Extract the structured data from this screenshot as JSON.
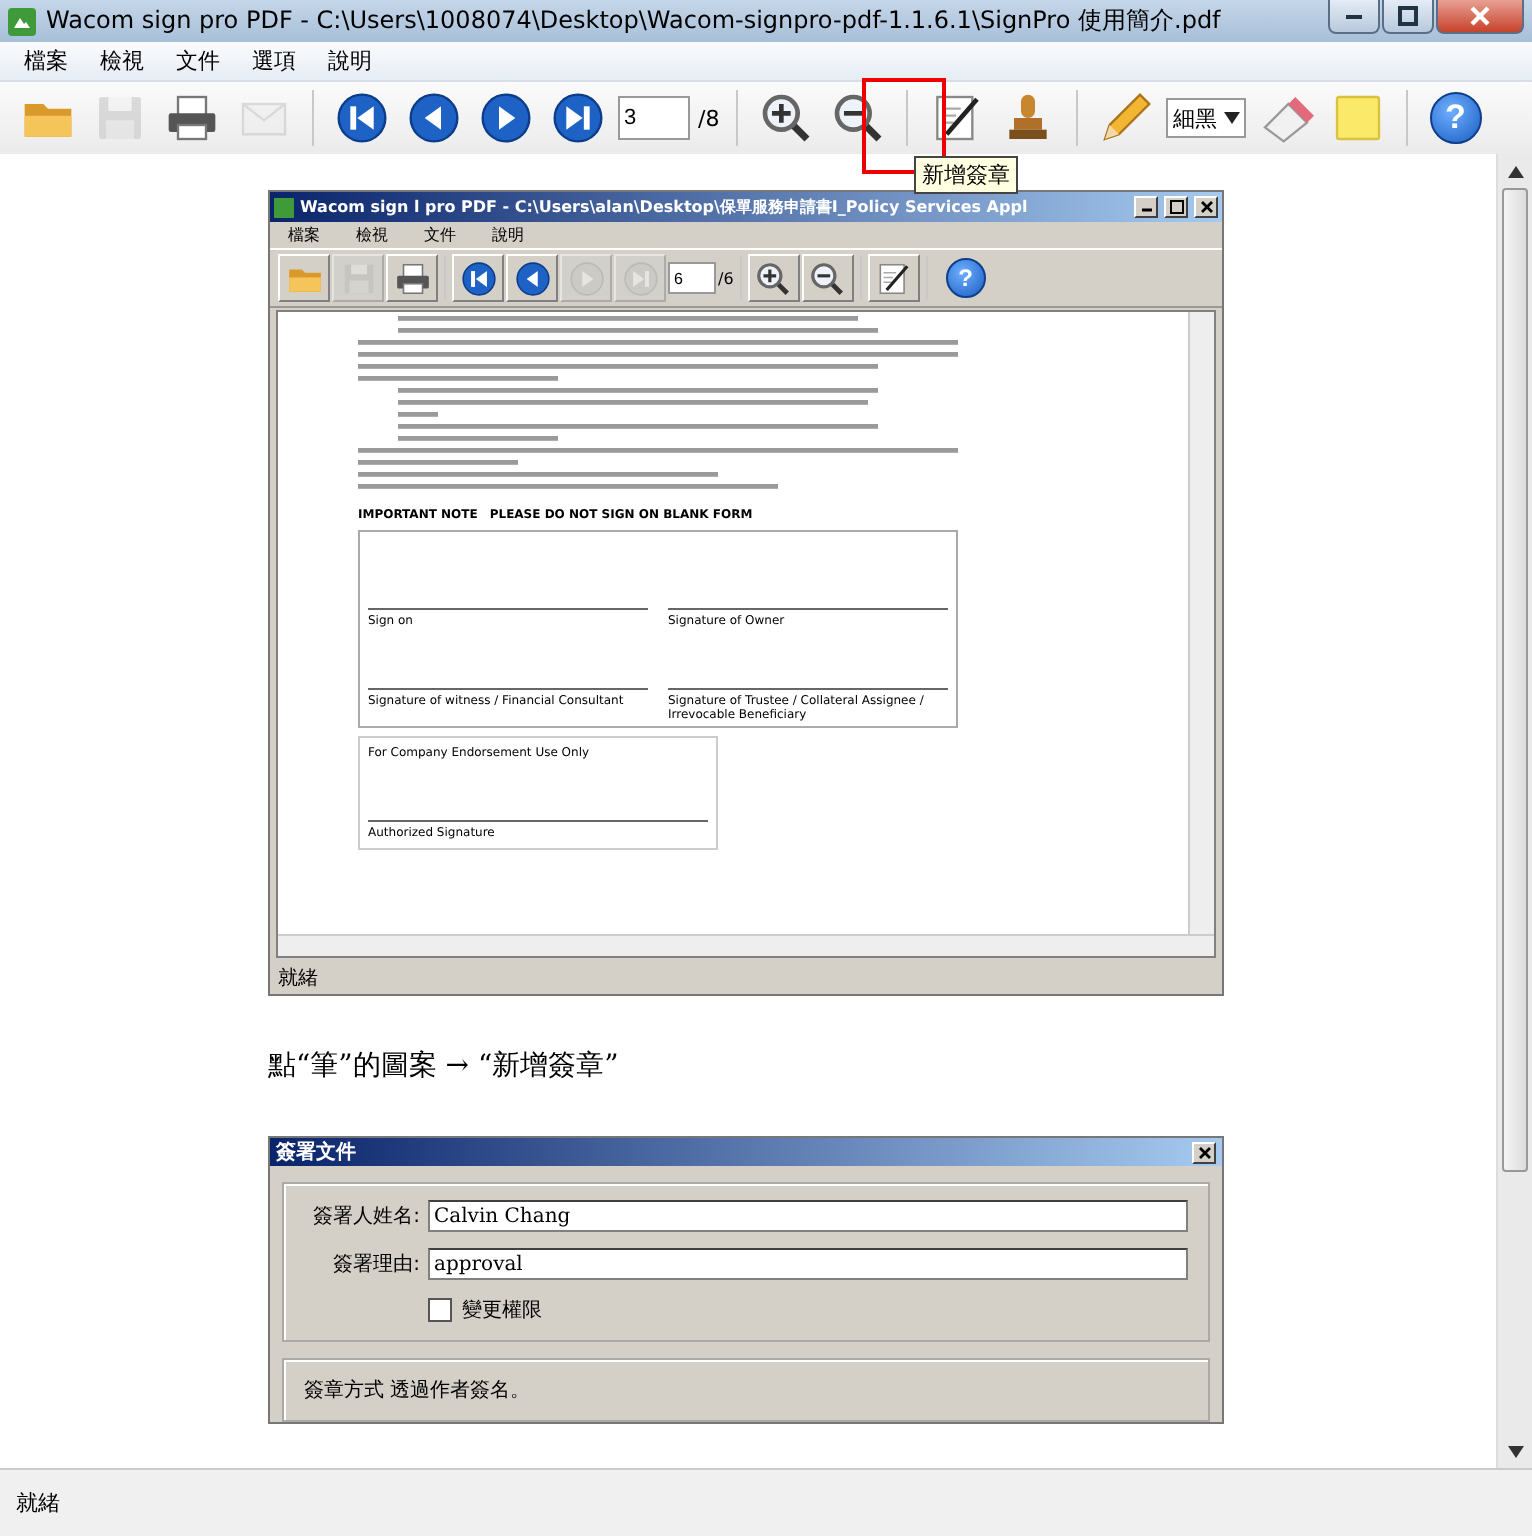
{
  "window": {
    "title": "Wacom sign pro PDF - C:\\Users\\1008074\\Desktop\\Wacom-signpro-pdf-1.1.6.1\\SignPro 使用簡介.pdf"
  },
  "menu": [
    "檔案",
    "檢視",
    "文件",
    "選項",
    "說明"
  ],
  "toolbar": {
    "items": [
      {
        "kind": "open",
        "disabled": false
      },
      {
        "kind": "save",
        "disabled": true
      },
      {
        "kind": "print",
        "disabled": false
      },
      {
        "kind": "mail",
        "disabled": true
      },
      {
        "kind": "separator"
      },
      {
        "kind": "first",
        "disabled": false
      },
      {
        "kind": "prev",
        "disabled": false
      },
      {
        "kind": "next",
        "disabled": false
      },
      {
        "kind": "last",
        "disabled": false
      },
      {
        "kind": "page",
        "value": "3",
        "total": "/8"
      },
      {
        "kind": "separator"
      },
      {
        "kind": "zoom-in",
        "disabled": false
      },
      {
        "kind": "zoom-out",
        "disabled": false
      },
      {
        "kind": "separator"
      },
      {
        "kind": "sign",
        "disabled": false
      },
      {
        "kind": "stamp",
        "disabled": false
      },
      {
        "kind": "separator"
      },
      {
        "kind": "pen",
        "disabled": false
      },
      {
        "kind": "select",
        "value": "細黑"
      },
      {
        "kind": "eraser",
        "disabled": false
      },
      {
        "kind": "note",
        "disabled": false
      },
      {
        "kind": "separator"
      },
      {
        "kind": "help",
        "label": "?",
        "disabled": false
      }
    ]
  },
  "tooltip": "新增簽章",
  "document": {
    "embedded_window": {
      "title": "Wacom sign l pro PDF - C:\\Users\\alan\\Desktop\\保單服務申請書I_Policy Services Appl",
      "menu": [
        "檔案",
        "檢視",
        "文件",
        "說明"
      ],
      "toolbar": {
        "items": [
          {
            "kind": "open",
            "disabled": false
          },
          {
            "kind": "save",
            "disabled": true
          },
          {
            "kind": "print",
            "disabled": false
          },
          {
            "kind": "separator"
          },
          {
            "kind": "first",
            "disabled": false
          },
          {
            "kind": "prev",
            "disabled": false
          },
          {
            "kind": "next",
            "disabled": true
          },
          {
            "kind": "last",
            "disabled": true
          },
          {
            "kind": "page",
            "value": "6",
            "total": "/6"
          },
          {
            "kind": "separator"
          },
          {
            "kind": "zoom-in",
            "disabled": false
          },
          {
            "kind": "zoom-out",
            "disabled": false
          },
          {
            "kind": "separator"
          },
          {
            "kind": "sign",
            "disabled": false
          },
          {
            "kind": "separator"
          },
          {
            "kind": "help",
            "label": "?",
            "disabled": false
          }
        ]
      },
      "form": {
        "note_heading": "IMPORTANT NOTE",
        "note_text": "PLEASE DO NOT SIGN ON BLANK FORM",
        "sign_on": "Sign on",
        "owner_signature": "Signature of Owner",
        "witness_signature": "Signature of witness / Financial Consultant",
        "trustee_signature": "Signature of Trustee / Collateral Assignee / Irrevocable Beneficiary",
        "company_use": "For Company Endorsement Use Only",
        "authorized_signature": "Authorized Signature"
      },
      "status": "就緒"
    },
    "caption": "點“筆”的圖案 → “新增簽章”",
    "dialog": {
      "title": "簽署文件",
      "fields": [
        {
          "label": "簽署人姓名:",
          "value": "Calvin Chang"
        },
        {
          "label": "簽署理由:",
          "value": "approval"
        }
      ],
      "checkbox": {
        "label": "變更權限",
        "checked": false
      },
      "method": "簽章方式 透過作者簽名。"
    }
  },
  "status_bar": "就緒"
}
